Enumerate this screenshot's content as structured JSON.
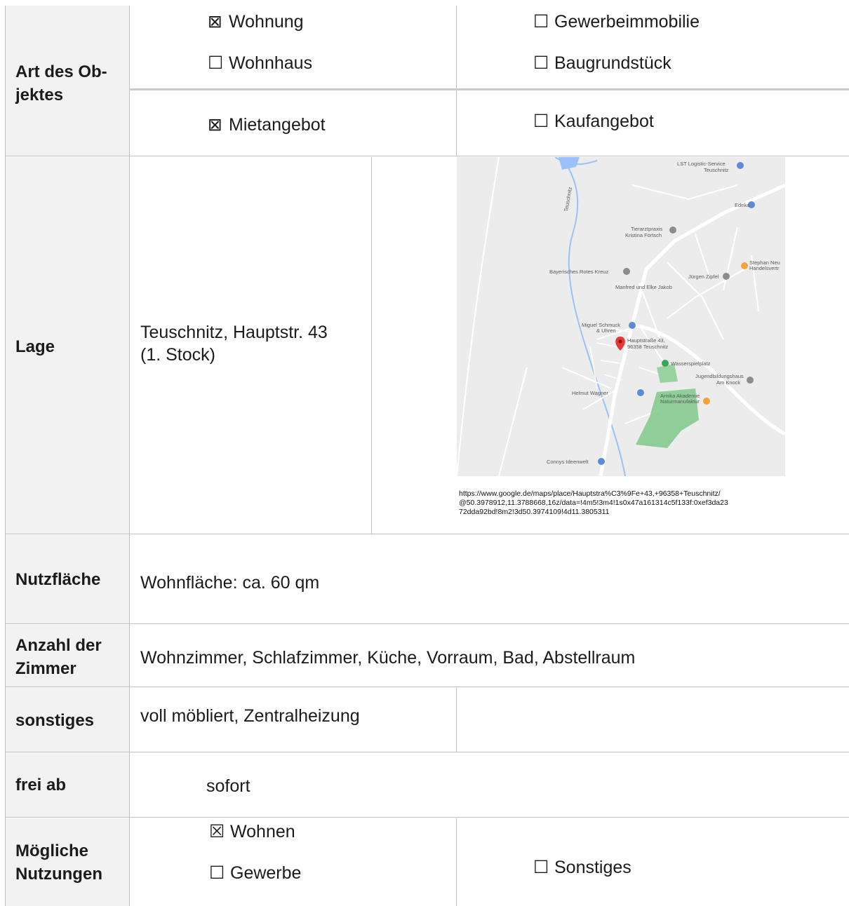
{
  "rows": {
    "art": {
      "label": "Art des Ob-\njektes",
      "options": [
        {
          "mark": "⊠",
          "text": "Wohnung"
        },
        {
          "mark": "☐",
          "text": "Gewerbeimmobilie"
        },
        {
          "mark": "☐",
          "text": "Wohnhaus"
        },
        {
          "mark": "☐",
          "text": "Baugrundstück"
        },
        {
          "mark": "⊠",
          "text": "Mietangebot"
        },
        {
          "mark": "☐",
          "text": "Kaufangebot"
        }
      ]
    },
    "lage": {
      "label": "Lage",
      "address_line1": "Teuschnitz, Hauptstr. 43",
      "address_line2": "(1. Stock)",
      "map_url": "https://www.google.de/maps/place/Hauptstra%C3%9Fe+43,+96358+Teuschnitz/\n@50.3978912,11.3788668,16z/data=!4m5!3m4!1s0x47a161314c5f133f:0xef3da23\n72dda92bd!8m2!3d50.3974109!4d11.3805311",
      "map_labels": {
        "lst": "LST Logistic-Service",
        "lst2": "Teuschnitz",
        "edeka": "Edeka",
        "tierarzt1": "Tierarztpraxis",
        "tierarzt2": "Kristina Förtsch",
        "brk": "Bayerisches Rotes Kreuz",
        "stephan1": "Stephan Neu",
        "stephan2": "Handelsvertr",
        "zipfel": "Jürgen Zipfel",
        "jakob": "Manfred und Elke Jakob",
        "schmuck1": "Miguel Schmuck",
        "schmuck2": "& Uhren",
        "haupt1": "Hauptstraße 43,",
        "haupt2": "96358 Teuschnitz",
        "wasser": "Wasserspielplatz",
        "jugend1": "Jugendbildungshaus",
        "jugend2": "Am Knock",
        "wagner": "Helmut Wagner",
        "arnika1": "Arnika Akademie",
        "arnika2": "Naturmanufaktur",
        "connys": "Connys Ideenwelt",
        "river": "Teuschnitz"
      }
    },
    "nutz": {
      "label": "Nutzfläche",
      "value": "Wohnfläche: ca. 60 qm"
    },
    "zimmer": {
      "label": "Anzahl der\nZimmer",
      "value": "Wohnzimmer, Schlafzimmer, Küche, Vorraum, Bad, Abstellraum"
    },
    "sonst": {
      "label": "sonstiges",
      "value": "voll möbliert, Zentralheizung"
    },
    "frei": {
      "label": "frei ab",
      "value": "sofort"
    },
    "nutzungen": {
      "label": "Mögliche\nNutzungen",
      "options": [
        {
          "mark": "☒",
          "text": "Wohnen"
        },
        {
          "mark": "☐",
          "text": "Gewerbe"
        },
        {
          "mark": "☐",
          "text": "Sonstiges"
        }
      ]
    }
  },
  "colors": {
    "label_bg": "#f2f2f2",
    "grid": "#bfbfbf",
    "map_road": "#ffffff",
    "map_park": "#7fc98a",
    "pin": "#e53935"
  }
}
